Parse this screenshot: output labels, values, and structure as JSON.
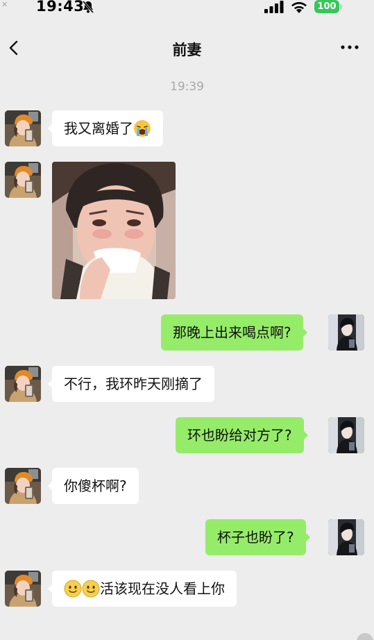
{
  "status_bar": {
    "time": "19:43",
    "battery": "100",
    "battery_color": "#34c759",
    "icons": [
      "bell-slash-icon",
      "signal-icon",
      "wifi-icon",
      "battery-icon"
    ]
  },
  "nav": {
    "title": "前妻",
    "back_icon": "chevron-left-icon",
    "more_icon": "more-dots-icon"
  },
  "chat": {
    "timestamp": "19:39",
    "colors": {
      "background": "#ededed",
      "incoming_bubble": "#ffffff",
      "outgoing_bubble": "#95ec69"
    },
    "messages": [
      {
        "from": "them",
        "type": "text",
        "text": "我又离婚了",
        "trailing_emoji": "loudly-crying-face-emoji"
      },
      {
        "from": "them",
        "type": "image",
        "description": "photo"
      },
      {
        "from": "me",
        "type": "text",
        "text": "那晚上出来喝点啊?"
      },
      {
        "from": "them",
        "type": "text",
        "text": "不行，我环昨天刚摘了"
      },
      {
        "from": "me",
        "type": "text",
        "text": "环也盼给对方了?"
      },
      {
        "from": "them",
        "type": "text",
        "text": "你傻杯啊?"
      },
      {
        "from": "me",
        "type": "text",
        "text": "杯子也盼了?"
      },
      {
        "from": "them",
        "type": "text",
        "text": "活该现在没人看上你",
        "leading_emoji": [
          "smiling-face-emoji",
          "smiling-face-emoji"
        ]
      }
    ]
  }
}
